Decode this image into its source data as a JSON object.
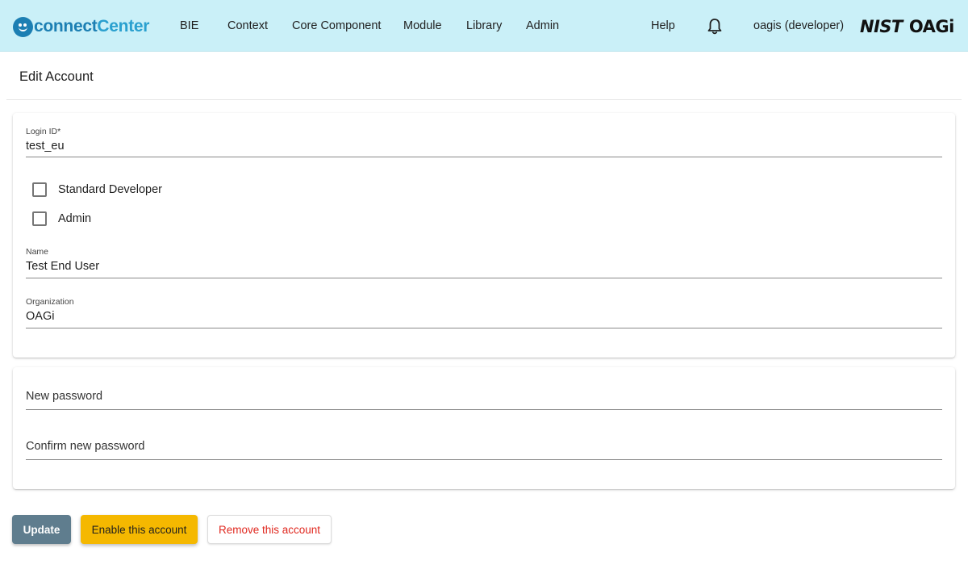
{
  "app": {
    "logo_text_1": "connect",
    "logo_text_2": "Center",
    "brand_1": "NIST",
    "brand_2": "OAGi"
  },
  "nav": {
    "items": [
      "BIE",
      "Context",
      "Core Component",
      "Module",
      "Library",
      "Admin"
    ],
    "help": "Help",
    "user": "oagis (developer)",
    "bell_icon": "bell-icon"
  },
  "page": {
    "title": "Edit Account"
  },
  "form": {
    "login_id": {
      "label": "Login ID*",
      "value": "test_eu"
    },
    "roles": [
      {
        "label": "Standard Developer",
        "checked": false
      },
      {
        "label": "Admin",
        "checked": false
      }
    ],
    "name": {
      "label": "Name",
      "value": "Test End User"
    },
    "organization": {
      "label": "Organization",
      "value": "OAGi"
    },
    "new_password": {
      "placeholder": "New password",
      "value": ""
    },
    "confirm_password": {
      "placeholder": "Confirm new password",
      "value": ""
    }
  },
  "actions": {
    "update": "Update",
    "enable": "Enable this account",
    "remove": "Remove this account"
  },
  "colors": {
    "topbar": "#caf0f8",
    "logo": "#1c7fb3",
    "update_button": "#5f7d8e",
    "enable_button": "#f5b800",
    "remove_text": "#e0281f"
  }
}
